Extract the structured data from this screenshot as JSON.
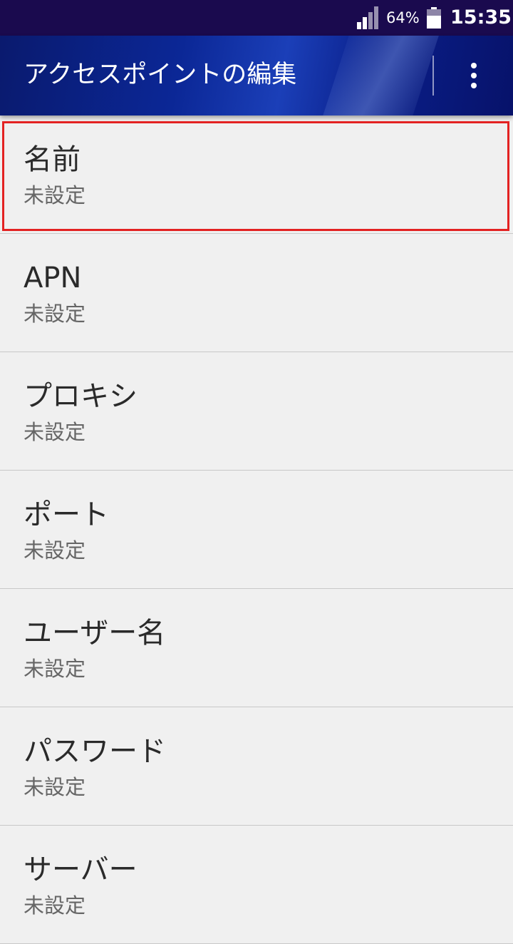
{
  "status_bar": {
    "battery_percent": "64%",
    "time": "15:35",
    "icons": [
      "cell-signal-icon",
      "battery-icon"
    ]
  },
  "app_bar": {
    "title": "アクセスポイントの編集",
    "menu_icon": "overflow-menu-icon"
  },
  "settings": {
    "items": [
      {
        "label": "名前",
        "value": "未設定"
      },
      {
        "label": "APN",
        "value": "未設定"
      },
      {
        "label": "プロキシ",
        "value": "未設定"
      },
      {
        "label": "ポート",
        "value": "未設定"
      },
      {
        "label": "ユーザー名",
        "value": "未設定"
      },
      {
        "label": "パスワード",
        "value": "未設定"
      },
      {
        "label": "サーバー",
        "value": "未設定"
      }
    ]
  },
  "colors": {
    "status_bar": "#1a0a4e",
    "app_bar": "#0b2796",
    "background": "#f0f0f0",
    "highlight": "#e32222"
  }
}
